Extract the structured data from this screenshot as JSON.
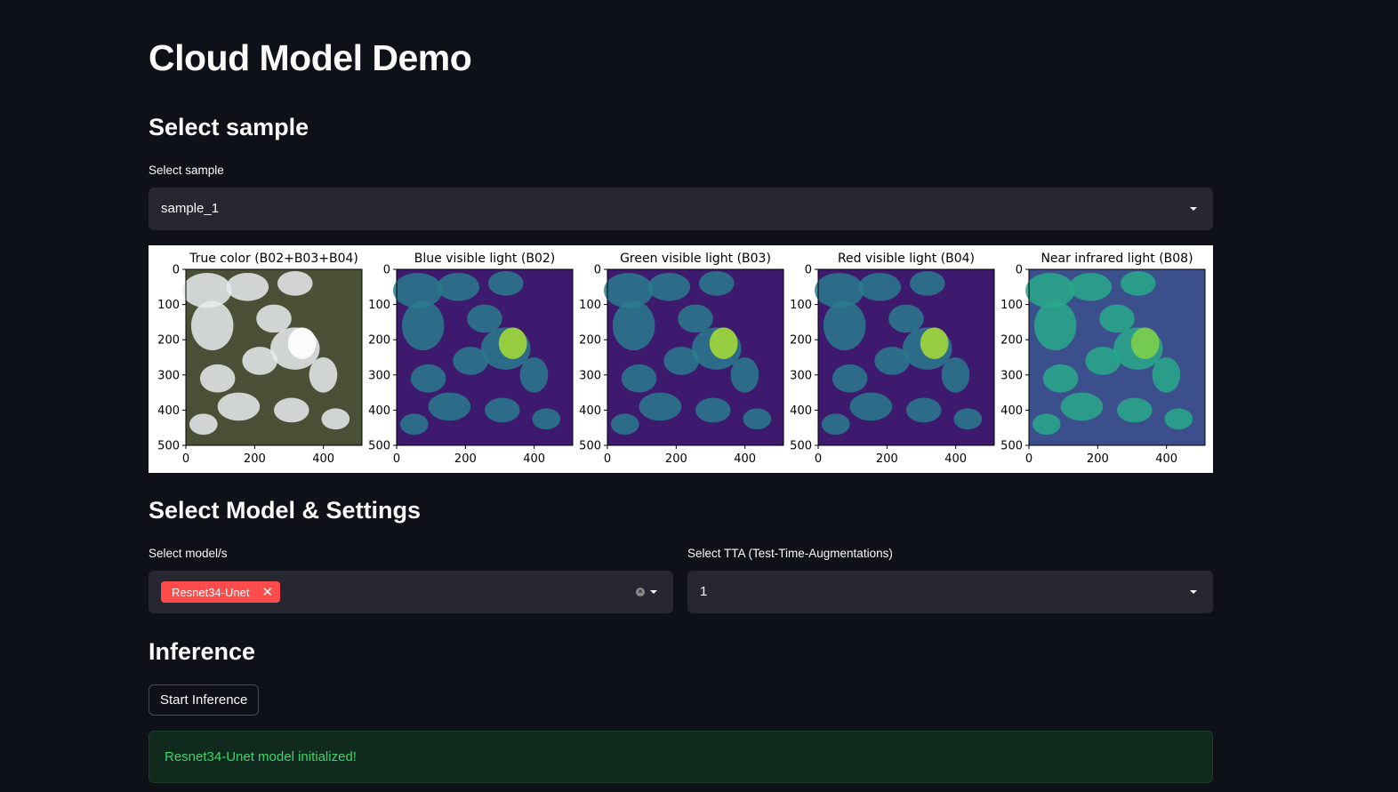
{
  "app": {
    "title": "Cloud Model Demo"
  },
  "sample_section": {
    "heading": "Select sample",
    "select_label": "Select sample",
    "selected_value": "sample_1"
  },
  "figure": {
    "panels": [
      {
        "title": "True color (B02+B03+B04)",
        "style": "truecolor"
      },
      {
        "title": "Blue visible light (B02)",
        "style": "viridis-dark"
      },
      {
        "title": "Green visible light (B03)",
        "style": "viridis-dark"
      },
      {
        "title": "Red visible light (B04)",
        "style": "viridis-dark"
      },
      {
        "title": "Near infrared light (B08)",
        "style": "viridis-mid"
      }
    ],
    "y_ticks": [
      "0",
      "100",
      "200",
      "300",
      "400",
      "500"
    ],
    "x_ticks": [
      "0",
      "200",
      "400"
    ]
  },
  "model_section": {
    "heading": "Select Model & Settings",
    "model_label": "Select model/s",
    "model_tags": [
      "Resnet34-Unet"
    ],
    "tta_label": "Select TTA (Test-Time-Augmentations)",
    "tta_value": "1"
  },
  "inference_section": {
    "heading": "Inference",
    "button_label": "Start Inference",
    "status_message": "Resnet34-Unet model initialized!"
  },
  "colors": {
    "background": "#0e1117",
    "input_bg": "#262730",
    "tag_red": "#ff4b4b",
    "success_text": "#3dd56d",
    "success_bg": "#112a1e"
  }
}
